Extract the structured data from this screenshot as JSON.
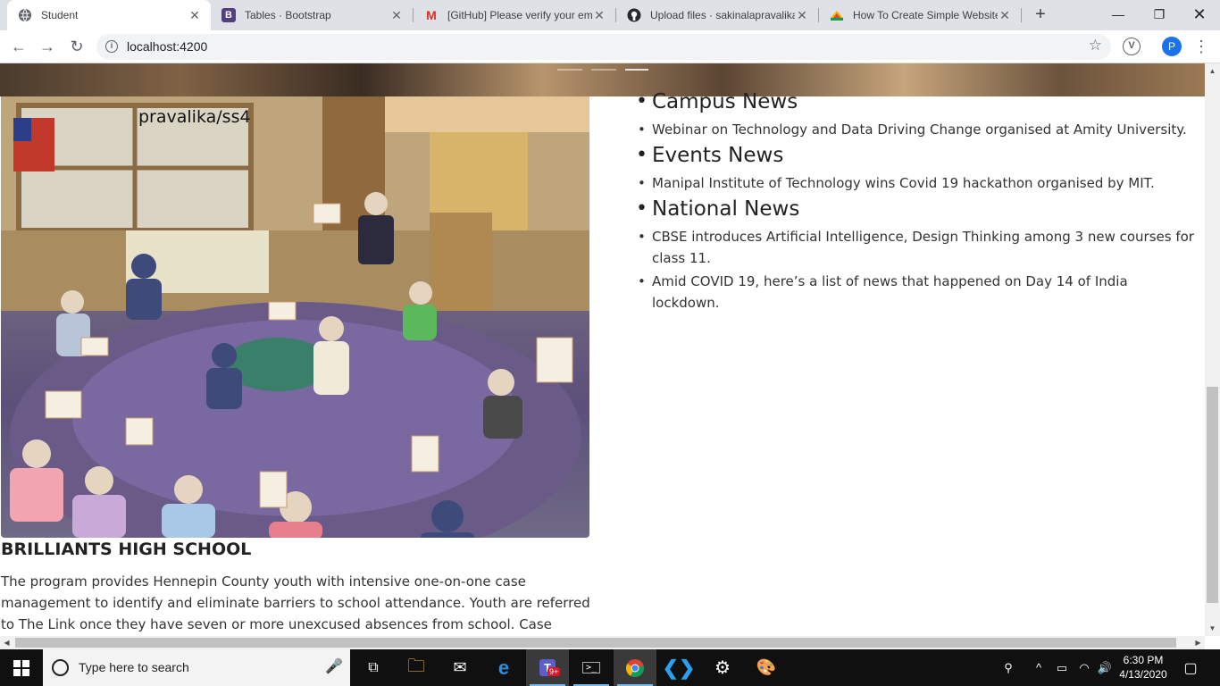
{
  "browser": {
    "tabs": [
      {
        "title": "Student",
        "favicon": "globe-icon",
        "active": true
      },
      {
        "title": "Tables · Bootstrap",
        "favicon": "bootstrap-icon",
        "active": false
      },
      {
        "title": "[GitHub] Please verify your em",
        "favicon": "gmail-icon",
        "active": false
      },
      {
        "title": "Upload files · sakinalapravalika",
        "favicon": "github-icon",
        "active": false
      },
      {
        "title": "How To Create Simple Website",
        "favicon": "colorful-hat-icon",
        "active": false
      }
    ],
    "new_tab": "+",
    "url": "localhost:4200",
    "profile_initial": "P",
    "extension_letter": "V"
  },
  "page": {
    "image_caption": "pravalika/ss4",
    "school_title": "BRILLIANTS HIGH SCHOOL",
    "school_description": "The program provides Hennepin County youth with intensive one-on-one case management to identify and eliminate barriers to school attendance. Youth are referred to The Link once they have seven or more unexcused absences from school. Case managers use a strength-",
    "news": [
      {
        "category": "Campus News",
        "items": [
          "Webinar on Technology and Data Driving Change organised at Amity University."
        ]
      },
      {
        "category": "Events News",
        "items": [
          "Manipal Institute of Technology wins Covid 19 hackathon organised by MIT."
        ]
      },
      {
        "category": "National News",
        "items": [
          "CBSE introduces Artificial Intelligence, Design Thinking among 3 new courses for class 11.",
          "Amid COVID 19, here’s a list of news that happened on Day 14 of India lockdown."
        ]
      }
    ]
  },
  "taskbar": {
    "search_placeholder": "Type here to search",
    "teams_badge": "9+",
    "time": "6:30 PM",
    "date": "4/13/2020"
  },
  "colors": {
    "accent": "#1a73e8",
    "tab_strip": "#dee1e6",
    "taskbar": "#101010"
  }
}
